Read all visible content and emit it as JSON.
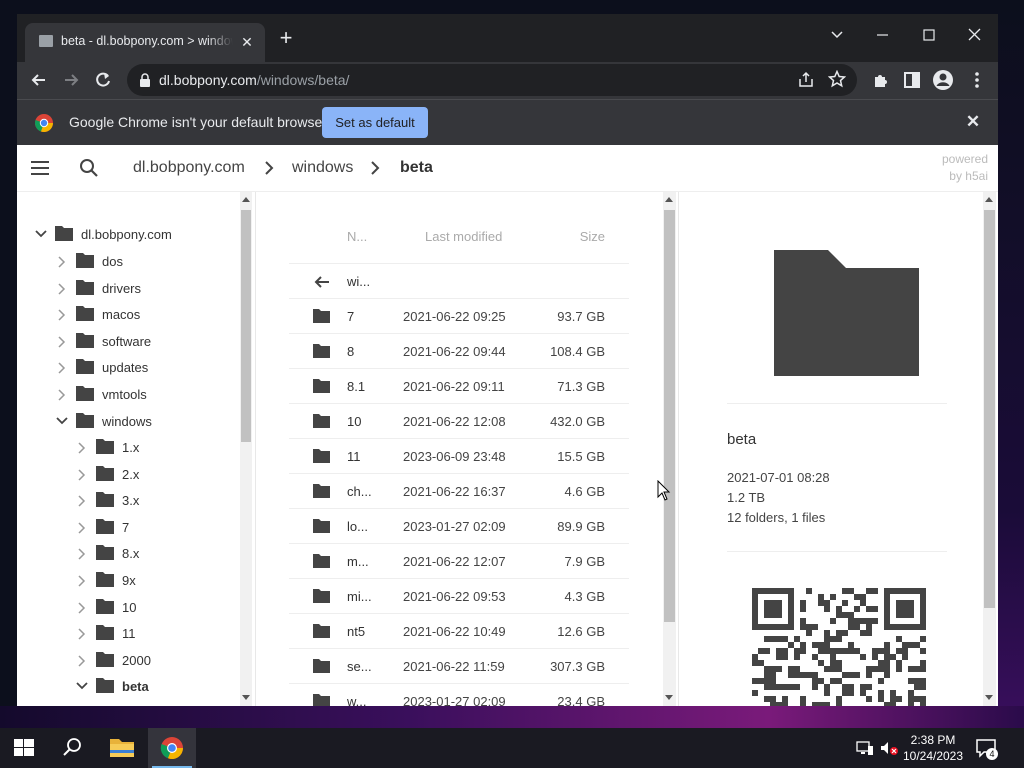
{
  "browser": {
    "tab_title": "beta - dl.bobpony.com > windows",
    "url_host": "dl.bobpony.com",
    "url_path": "/windows/beta/",
    "infobar_message": "Google Chrome isn't your default browser",
    "set_default_label": "Set as default"
  },
  "page": {
    "breadcrumb": [
      "dl.bobpony.com",
      "windows",
      "beta"
    ],
    "powered_by": [
      "powered",
      "by h5ai"
    ]
  },
  "tree": {
    "root": "dl.bobpony.com",
    "items": [
      "dos",
      "drivers",
      "macos",
      "software",
      "updates",
      "vmtools",
      "windows"
    ],
    "windows_children": [
      "1.x",
      "2.x",
      "3.x",
      "7",
      "8.x",
      "9x",
      "10",
      "11",
      "2000",
      "beta"
    ]
  },
  "list": {
    "headers": {
      "name": "N...",
      "modified": "Last modified",
      "size": "Size"
    },
    "parent_label": "wi...",
    "rows": [
      {
        "name": "7",
        "date": "2021-06-22 09:25",
        "size": "93.7 GB"
      },
      {
        "name": "8",
        "date": "2021-06-22 09:44",
        "size": "108.4 GB"
      },
      {
        "name": "8.1",
        "date": "2021-06-22 09:11",
        "size": "71.3 GB"
      },
      {
        "name": "10",
        "date": "2021-06-22 12:08",
        "size": "432.0 GB"
      },
      {
        "name": "11",
        "date": "2023-06-09 23:48",
        "size": "15.5 GB"
      },
      {
        "name": "ch...",
        "date": "2021-06-22 16:37",
        "size": "4.6 GB"
      },
      {
        "name": "lo...",
        "date": "2023-01-27 02:09",
        "size": "89.9 GB"
      },
      {
        "name": "m...",
        "date": "2021-06-22 12:07",
        "size": "7.9 GB"
      },
      {
        "name": "mi...",
        "date": "2021-06-22 09:53",
        "size": "4.3 GB"
      },
      {
        "name": "nt5",
        "date": "2021-06-22 10:49",
        "size": "12.6 GB"
      },
      {
        "name": "se...",
        "date": "2021-06-22 11:59",
        "size": "307.3 GB"
      },
      {
        "name": "w...",
        "date": "2023-01-27 02:09",
        "size": "23.4 GB"
      }
    ]
  },
  "info": {
    "name": "beta",
    "modified": "2021-07-01 08:28",
    "size": "1.2 TB",
    "contents": "12 folders, 1 files"
  },
  "taskbar": {
    "time": "2:38 PM",
    "date": "10/24/2023",
    "notification_count": "4"
  },
  "colors": {
    "accent_button": "#8ab4f8",
    "chrome_dark": "#202124",
    "chrome_toolbar": "#35363a",
    "folder": "#444444"
  }
}
